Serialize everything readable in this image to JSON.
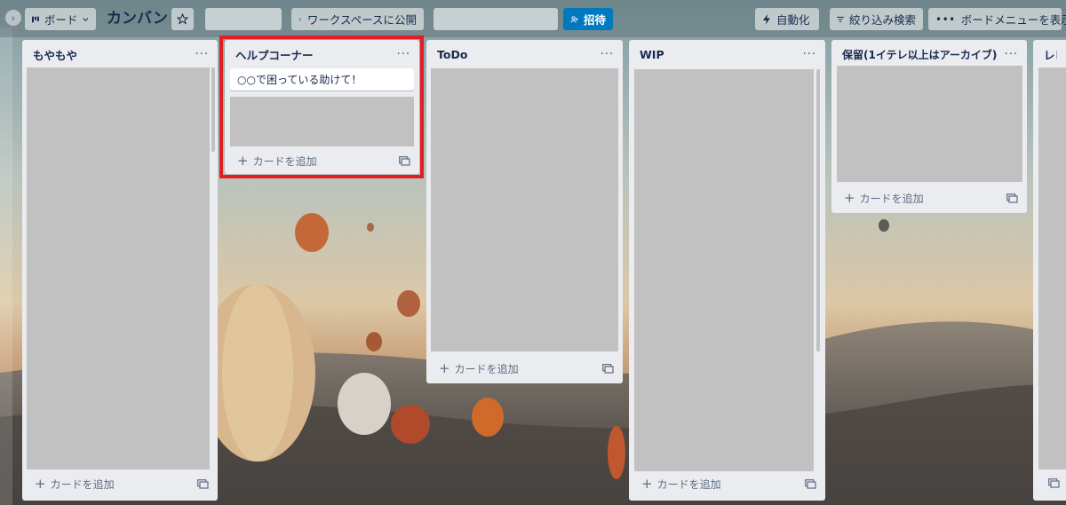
{
  "header": {
    "board_view_label": "ボード",
    "board_title": "カンバン",
    "visibility_label": "ワークスペースに公開",
    "invite_label": "招待",
    "automation_label": "自動化",
    "filter_label": "絞り込み検索",
    "board_menu_label": "ボードメニューを表示"
  },
  "lists": [
    {
      "title": "もやもや",
      "add_card_label": "カードを追加"
    },
    {
      "title": "ヘルプコーナー",
      "add_card_label": "カードを追加",
      "cards": [
        "○○で困っている助けて！"
      ]
    },
    {
      "title": "ToDo",
      "add_card_label": "カードを追加"
    },
    {
      "title": "WIP",
      "add_card_label": "カードを追加"
    },
    {
      "title": "保留(1イテレ以上はアーカイブ)",
      "add_card_label": "カードを追加"
    },
    {
      "title": "レビ"
    }
  ],
  "colors": {
    "accent": "#0079bf",
    "highlight": "#e01e26",
    "list_bg": "#ebecf0",
    "placeholder": "#c1c1c1"
  },
  "icons": [
    "sidebar-expand-icon",
    "board-view-icon",
    "chevron-down-icon",
    "star-icon",
    "people-icon",
    "add-person-icon",
    "bolt-icon",
    "filter-icon",
    "more-icon",
    "plus-icon",
    "card-template-icon"
  ]
}
